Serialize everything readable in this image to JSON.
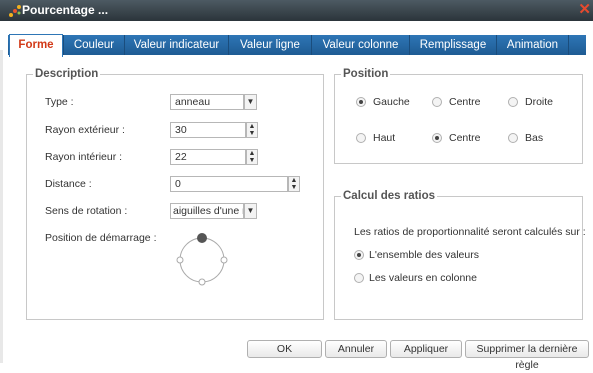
{
  "window": {
    "title": "Pourcentage ..."
  },
  "tabs": [
    {
      "label": "Forme",
      "active": true
    },
    {
      "label": "Couleur"
    },
    {
      "label": "Valeur indicateur"
    },
    {
      "label": "Valeur ligne"
    },
    {
      "label": "Valeur colonne"
    },
    {
      "label": "Remplissage"
    },
    {
      "label": "Animation"
    }
  ],
  "description": {
    "legend": "Description",
    "type_label": "Type :",
    "type_value": "anneau",
    "outer_label": "Rayon extérieur :",
    "outer_value": "30",
    "inner_label": "Rayon intérieur :",
    "inner_value": "22",
    "distance_label": "Distance :",
    "distance_value": "0",
    "rotation_label": "Sens de rotation :",
    "rotation_value": "aiguilles d'une m",
    "start_label": "Position de démarrage :"
  },
  "position": {
    "legend": "Position",
    "horizontal": [
      {
        "label": "Gauche",
        "checked": true
      },
      {
        "label": "Centre",
        "checked": false
      },
      {
        "label": "Droite",
        "checked": false
      }
    ],
    "vertical": [
      {
        "label": "Haut",
        "checked": false
      },
      {
        "label": "Centre",
        "checked": true
      },
      {
        "label": "Bas",
        "checked": false
      }
    ]
  },
  "ratios": {
    "legend": "Calcul des ratios",
    "intro": "Les ratios de proportionnalité seront calculés sur :",
    "options": [
      {
        "label": "L'ensemble des valeurs",
        "checked": true
      },
      {
        "label": "Les valeurs en colonne",
        "checked": false
      }
    ]
  },
  "buttons": {
    "ok": "OK",
    "cancel": "Annuler",
    "apply": "Appliquer",
    "delete_rule": "Supprimer la dernière règle"
  },
  "colors": {
    "tab_blue": "#2e76b6",
    "active_tab_text": "#d23a18",
    "close_red": "#e64a2e"
  }
}
